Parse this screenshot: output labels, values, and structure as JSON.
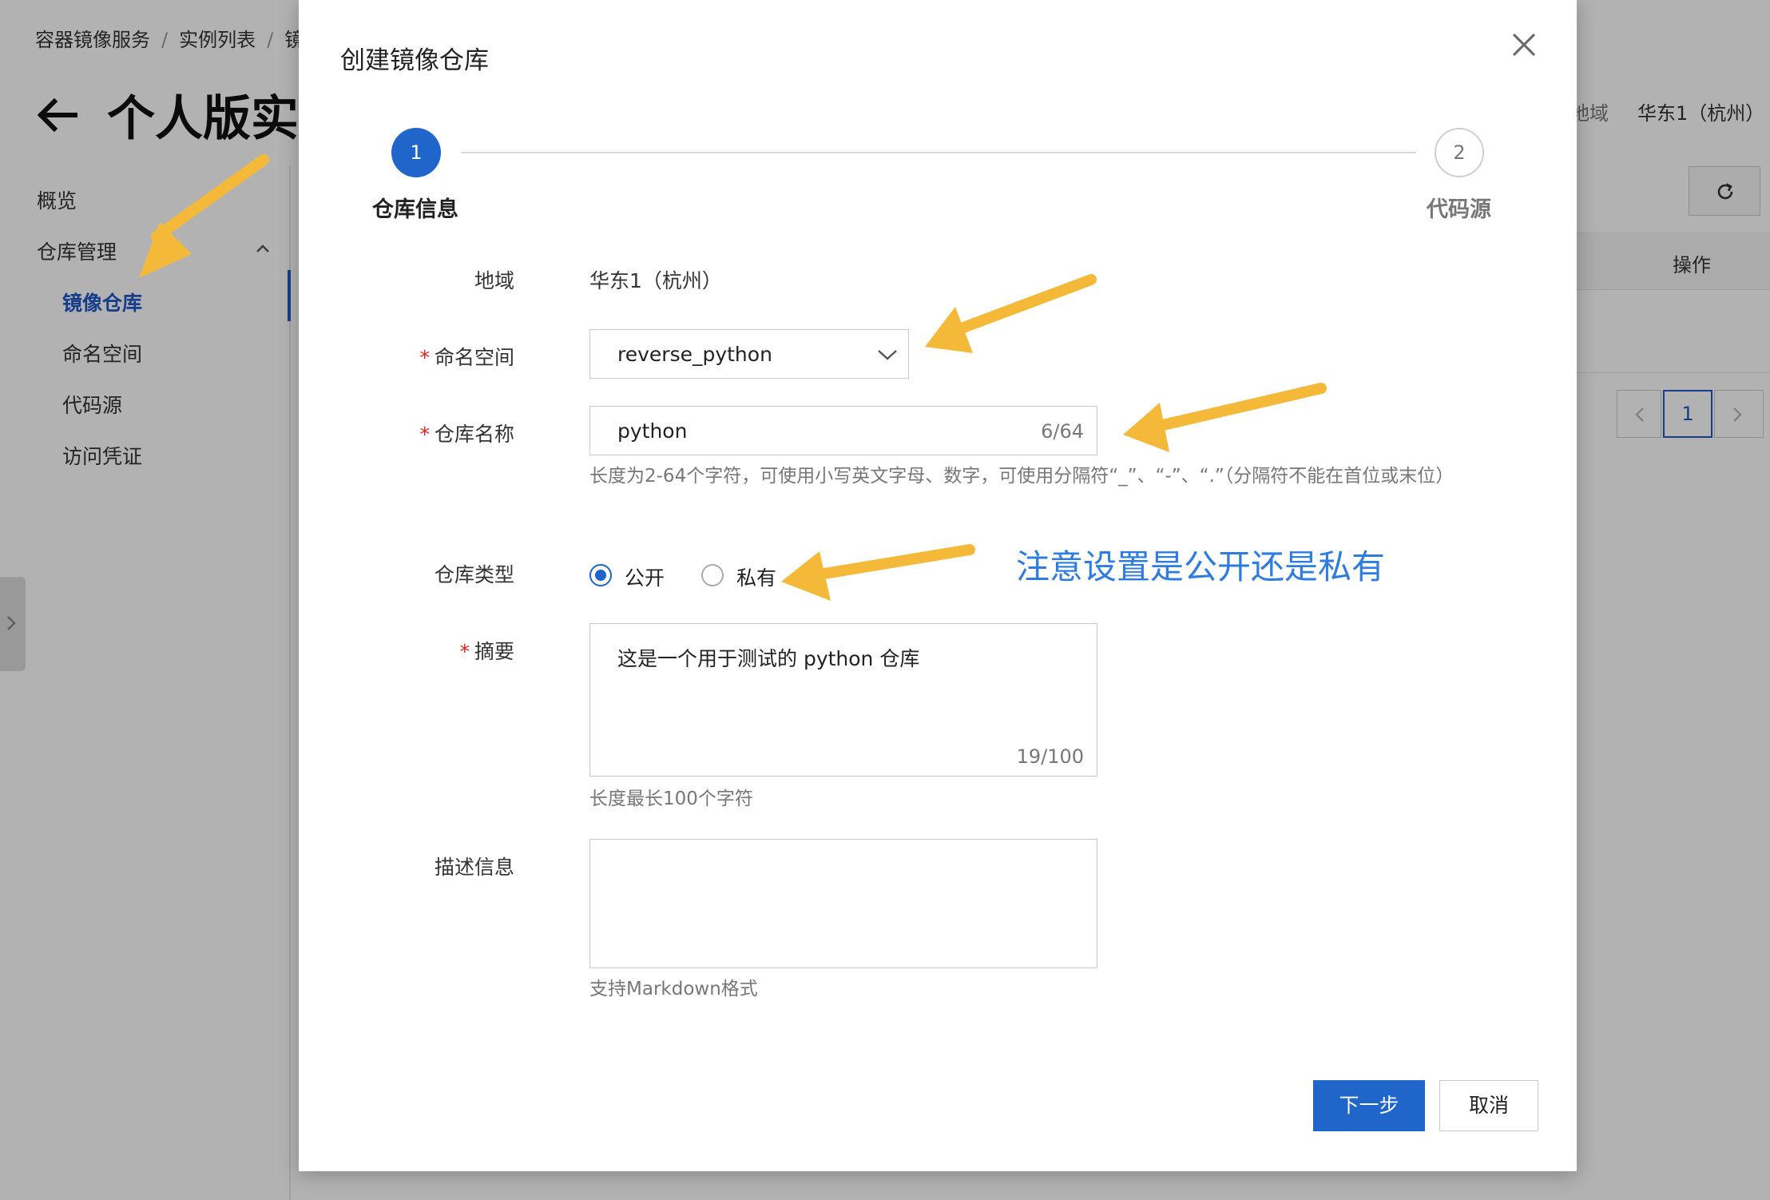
{
  "background": {
    "breadcrumb": [
      "容器镜像服务",
      "实例列表",
      "镜"
    ],
    "page_title": "个人版实例",
    "sidebar": {
      "items": [
        {
          "label": "概览"
        },
        {
          "label": "仓库管理"
        },
        {
          "label": "镜像仓库"
        },
        {
          "label": "命名空间"
        },
        {
          "label": "代码源"
        },
        {
          "label": "访问凭证"
        }
      ]
    },
    "region_label": "地域",
    "region_value": "华东1（杭州）",
    "table_header_op": "操作",
    "pagination": {
      "current_page": "1"
    }
  },
  "modal": {
    "title": "创建镜像仓库",
    "steps": [
      {
        "number": "1",
        "label": "仓库信息"
      },
      {
        "number": "2",
        "label": "代码源"
      }
    ],
    "form": {
      "region": {
        "label": "地域",
        "value": "华东1（杭州）"
      },
      "namespace": {
        "label": "命名空间",
        "value": "reverse_python"
      },
      "repo_name": {
        "label": "仓库名称",
        "value": "python",
        "count": "6/64",
        "help": "长度为2-64个字符，可使用小写英文字母、数字，可使用分隔符“_”、“-”、“.”（分隔符不能在首位或末位）"
      },
      "repo_type": {
        "label": "仓库类型",
        "option_public": "公开",
        "option_private": "私有",
        "selected": "公开"
      },
      "summary": {
        "label": "摘要",
        "value": "这是一个用于测试的 python 仓库",
        "count": "19/100",
        "help": "长度最长100个字符"
      },
      "description": {
        "label": "描述信息",
        "value": "",
        "help": "支持Markdown格式"
      }
    },
    "buttons": {
      "next": "下一步",
      "cancel": "取消"
    }
  },
  "annotation": {
    "note": "注意设置是公开还是私有"
  },
  "colors": {
    "primary": "#2065c9",
    "annotation_arrow": "#f5b93a",
    "annotation_text": "#2e7ce0",
    "required_mark": "#e02020"
  }
}
